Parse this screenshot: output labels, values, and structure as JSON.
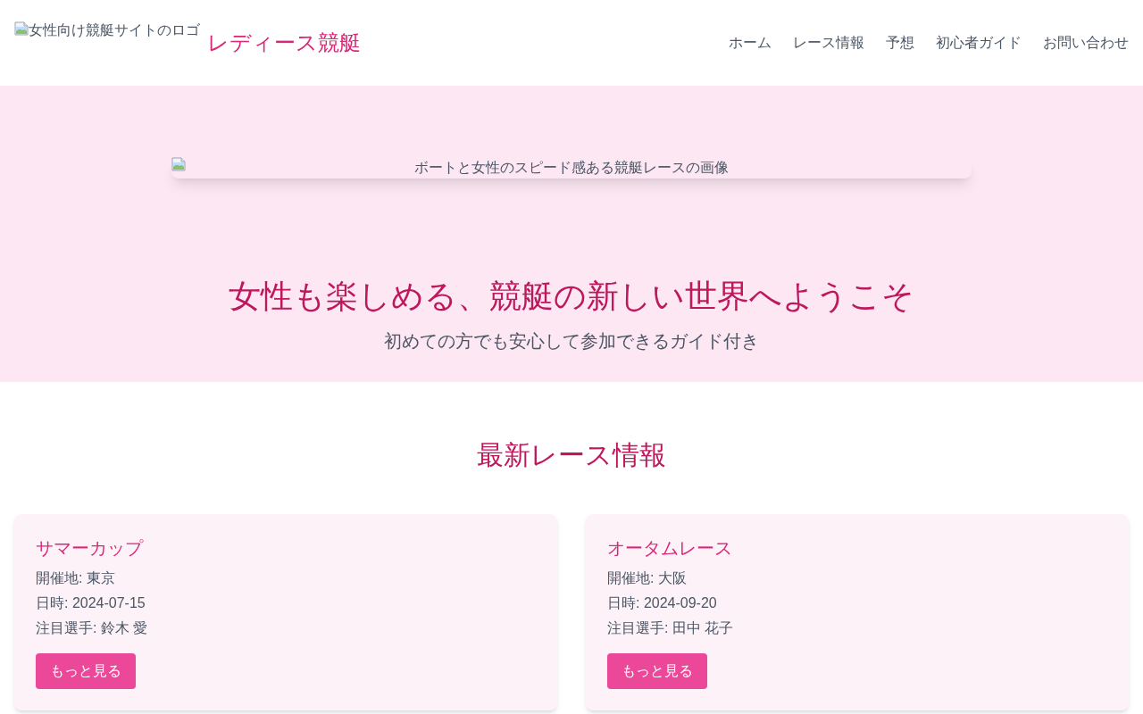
{
  "header": {
    "logo": {
      "alt": "女性向け競艇サイトのロゴ"
    },
    "site_title": "レディース競艇",
    "nav": [
      "ホーム",
      "レース情報",
      "予想",
      "初心者ガイド",
      "お問い合わせ"
    ]
  },
  "hero": {
    "image": {
      "alt": "ボートと女性のスピード感ある競艇レースの画像"
    },
    "title": "女性も楽しめる、競艇の新しい世界へようこそ",
    "subtitle": "初めての方でも安心して参加できるガイド付き"
  },
  "races": {
    "heading": "最新レース情報",
    "cards": [
      {
        "name": "サマーカップ",
        "venue": "開催地: 東京",
        "date": "日時: 2024-07-15",
        "featured_racer": "注目選手: 鈴木 愛",
        "button": "もっと見る"
      },
      {
        "name": "オータムレース",
        "venue": "開催地: 大阪",
        "date": "日時: 2024-09-20",
        "featured_racer": "注目選手: 田中 花子",
        "button": "もっと見る"
      }
    ]
  }
}
